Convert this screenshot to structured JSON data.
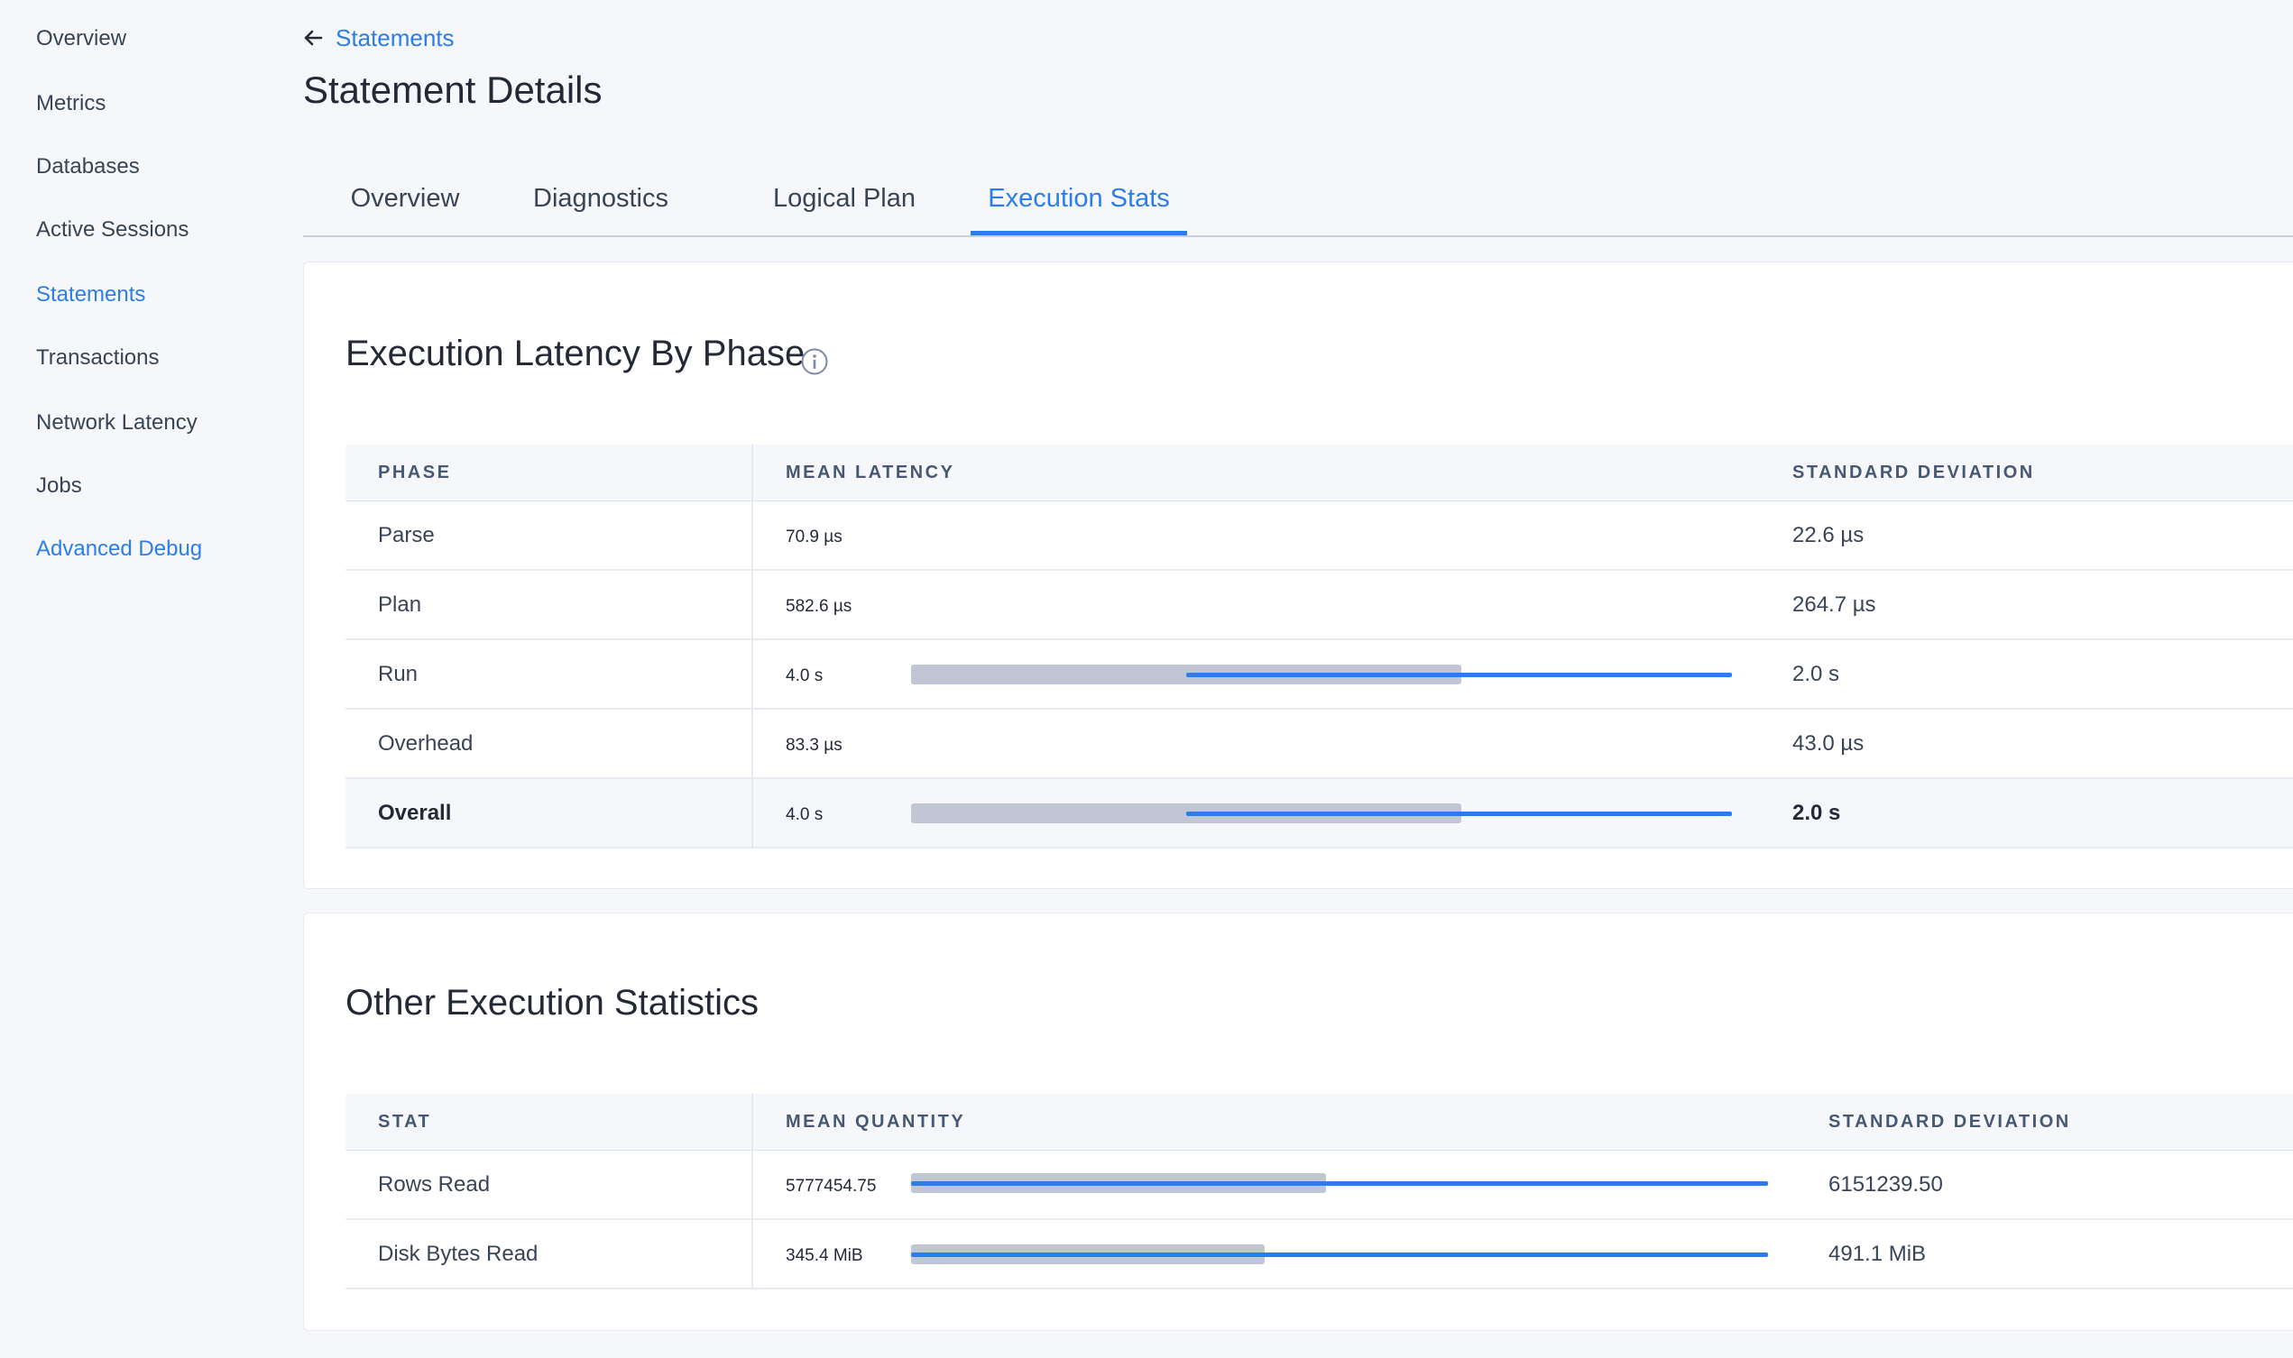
{
  "sidebar": {
    "items": [
      {
        "label": "Overview"
      },
      {
        "label": "Metrics"
      },
      {
        "label": "Databases"
      },
      {
        "label": "Active Sessions"
      },
      {
        "label": "Statements"
      },
      {
        "label": "Transactions"
      },
      {
        "label": "Network Latency"
      },
      {
        "label": "Jobs"
      },
      {
        "label": "Advanced Debug"
      }
    ],
    "active_item": "Statements"
  },
  "breadcrumb": {
    "label": "Statements"
  },
  "page": {
    "title": "Statement Details"
  },
  "tabs": [
    {
      "label": "Overview"
    },
    {
      "label": "Diagnostics"
    },
    {
      "label": "Logical Plan"
    },
    {
      "label": "Execution Stats"
    }
  ],
  "active_tab": "Execution Stats",
  "latency": {
    "title": "Execution Latency By Phase",
    "headers": {
      "phase": "PHASE",
      "mean": "MEAN LATENCY",
      "stddev": "STANDARD DEVIATION"
    },
    "rows": [
      {
        "phase": "Parse",
        "mean": "70.9 µs",
        "stddev": "22.6 µs"
      },
      {
        "phase": "Plan",
        "mean": "582.6 µs",
        "stddev": "264.7 µs"
      },
      {
        "phase": "Run",
        "mean": "4.0 s",
        "stddev": "2.0 s"
      },
      {
        "phase": "Overhead",
        "mean": "83.3 µs",
        "stddev": "43.0 µs"
      },
      {
        "phase": "Overall",
        "mean": "4.0 s",
        "stddev": "2.0 s"
      }
    ]
  },
  "other": {
    "title": "Other Execution Statistics",
    "headers": {
      "stat": "STAT",
      "mean": "MEAN QUANTITY",
      "stddev": "STANDARD DEVIATION"
    },
    "rows": [
      {
        "stat": "Rows Read",
        "mean": "5777454.75",
        "stddev": "6151239.50"
      },
      {
        "stat": "Disk Bytes Read",
        "mean": "345.4 MiB",
        "stddev": "491.1 MiB"
      }
    ]
  },
  "colors": {
    "accent": "#2b7de9",
    "bar_mean": "#c0c6d4"
  }
}
